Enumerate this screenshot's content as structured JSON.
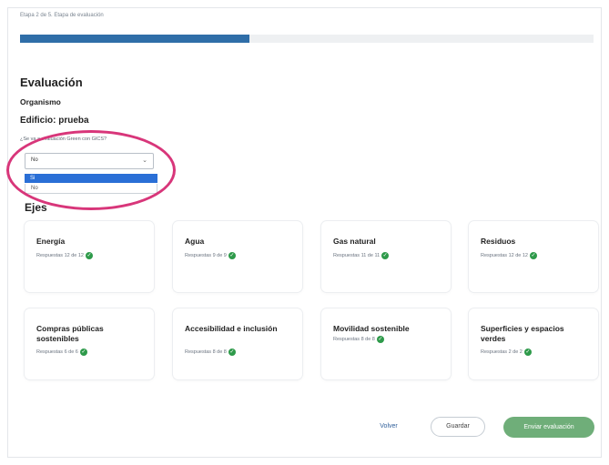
{
  "header": {
    "step_label": "Etapa 2 de 5. Etapa de evaluación",
    "progress": 0.4
  },
  "main": {
    "title": "Evaluación",
    "organismo": "Organismo",
    "edificio": "Edificio: prueba",
    "question": "¿Se va a evaluación Green con GICS?",
    "select": {
      "value": "No",
      "options": [
        "Si",
        "No"
      ]
    },
    "ejes_title": "Ejes"
  },
  "ejes": [
    {
      "name": "Energía",
      "responses": "Respuestas 12 de 12"
    },
    {
      "name": "Agua",
      "responses": "Respuestas 9 de 9"
    },
    {
      "name": "Gas natural",
      "responses": "Respuestas 11 de 11"
    },
    {
      "name": "Residuos",
      "responses": "Respuestas 12 de 12"
    },
    {
      "name": "Compras públicas sostenibles",
      "responses": "Respuestas 6 de 6"
    },
    {
      "name": "Accesibilidad e inclusión",
      "responses": "Respuestas 8 de 8"
    },
    {
      "name": "Movilidad sostenible",
      "responses": "Respuestas 8 de 8"
    },
    {
      "name": "Superficies y espacios verdes",
      "responses": "Respuestas 2 de 2"
    }
  ],
  "footer": {
    "volver": "Volver",
    "guardar": "Guardar",
    "enviar": "Enviar evaluación"
  },
  "colors": {
    "progress": "#2f6ea8",
    "highlight": "#d8367a",
    "check": "#2e9a4a",
    "enviar": "#6fae79"
  }
}
